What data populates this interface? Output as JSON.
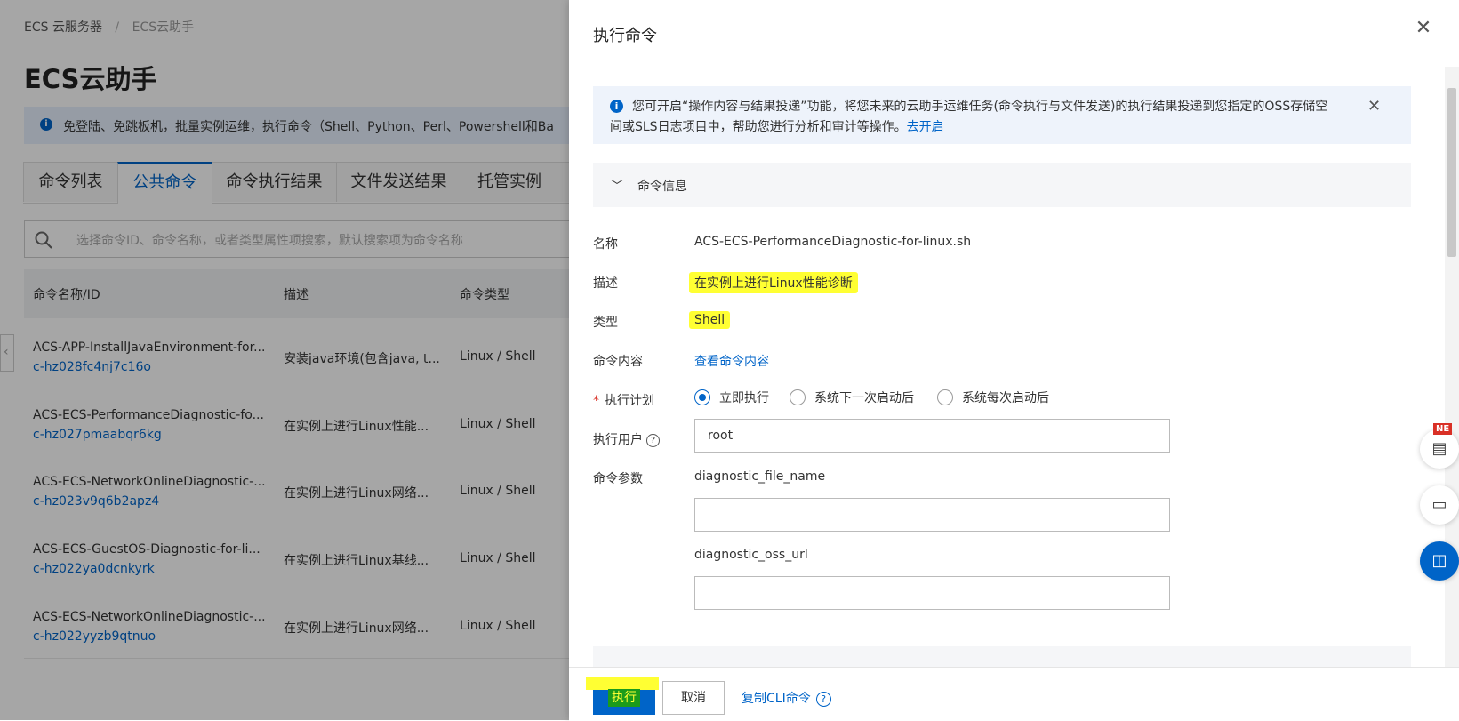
{
  "breadcrumb": {
    "item1": "ECS 云服务器",
    "sep": "/",
    "item2": "ECS云助手"
  },
  "page_title": "ECS云助手",
  "info_bar": {
    "text": "免登陆、免跳板机，批量实例运维，执行命令（Shell、Python、Perl、Powershell和Ba"
  },
  "tabs": [
    "命令列表",
    "公共命令",
    "命令执行结果",
    "文件发送结果",
    "托管实例"
  ],
  "search": {
    "placeholder": "选择命令ID、命令名称，或者类型属性项搜索，默认搜索项为命令名称"
  },
  "table": {
    "headers": [
      "命令名称/ID",
      "描述",
      "命令类型"
    ],
    "rows": [
      {
        "name": "ACS-APP-InstallJavaEnvironment-for...",
        "id": "c-hz028fc4nj7c16o",
        "desc": "安装java环境(包含java, t...",
        "type": "Linux / Shell"
      },
      {
        "name": "ACS-ECS-PerformanceDiagnostic-fo...",
        "id": "c-hz027pmaabqr6kg",
        "desc": "在实例上进行Linux性能...",
        "type": "Linux / Shell"
      },
      {
        "name": "ACS-ECS-NetworkOnlineDiagnostic-...",
        "id": "c-hz023v9q6b2apz4",
        "desc": "在实例上进行Linux网络...",
        "type": "Linux / Shell"
      },
      {
        "name": "ACS-ECS-GuestOS-Diagnostic-for-li...",
        "id": "c-hz022ya0dcnkyrk",
        "desc": "在实例上进行Linux基线...",
        "type": "Linux / Shell"
      },
      {
        "name": "ACS-ECS-NetworkOnlineDiagnostic-...",
        "id": "c-hz022yyzb9qtnuo",
        "desc": "在实例上进行Linux网络...",
        "type": "Linux / Shell"
      }
    ]
  },
  "drawer": {
    "title": "执行命令",
    "notice": {
      "line1": "您可开启“操作内容与结果投递”功能，将您未来的云助手运维任务(命令执行与文件发送)的执行结果投递到您指定的OSS存储空",
      "line2": "间或SLS日志项目中，帮助您进行分析和审计等操作。",
      "link": "去开启"
    },
    "section_title": "命令信息",
    "fields": {
      "name_label": "名称",
      "name_value": "ACS-ECS-PerformanceDiagnostic-for-linux.sh",
      "desc_label": "描述",
      "desc_value": "在实例上进行Linux性能诊断",
      "type_label": "类型",
      "type_value": "Shell",
      "content_label": "命令内容",
      "content_link": "查看命令内容",
      "plan_label": "执行计划",
      "plan_options": [
        "立即执行",
        "系统下一次启动后",
        "系统每次启动后"
      ],
      "plan_selected": "立即执行",
      "user_label": "执行用户",
      "user_value": "root",
      "params_label": "命令参数",
      "param1_name": "diagnostic_file_name",
      "param1_value": "",
      "param2_name": "diagnostic_oss_url",
      "param2_value": ""
    },
    "footer": {
      "execute": "执行",
      "cancel": "取消",
      "copy_cli": "复制CLI命令"
    }
  },
  "float_tools": {
    "badge": "NE"
  },
  "colors": {
    "primary": "#0064c8",
    "highlight": "#ffff33",
    "required": "#d93026"
  }
}
